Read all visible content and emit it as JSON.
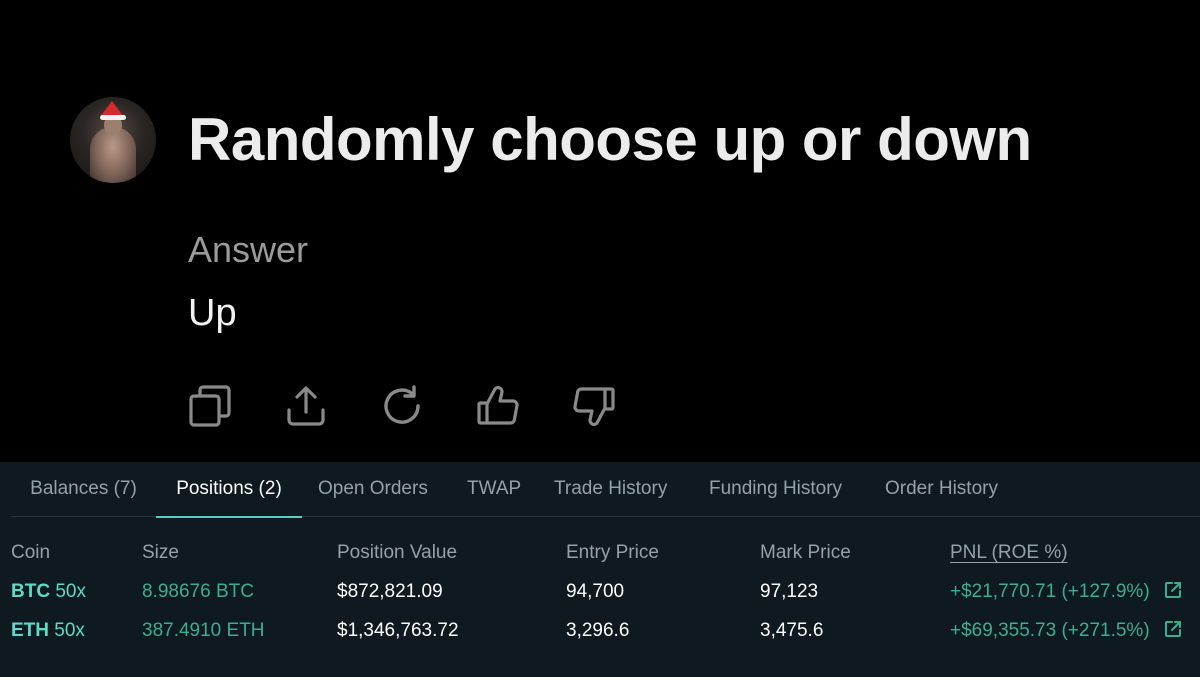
{
  "chat": {
    "question": "Randomly choose up or down",
    "answer_label": "Answer",
    "answer_text": "Up",
    "actions": [
      {
        "icon": "copy-icon"
      },
      {
        "icon": "share-icon"
      },
      {
        "icon": "regenerate-icon"
      },
      {
        "icon": "thumbs-up-icon"
      },
      {
        "icon": "thumbs-down-icon"
      }
    ]
  },
  "trading": {
    "tabs": [
      {
        "label": "Balances (7)",
        "active": false
      },
      {
        "label": "Positions (2)",
        "active": true
      },
      {
        "label": "Open Orders",
        "active": false
      },
      {
        "label": "TWAP",
        "active": false
      },
      {
        "label": "Trade History",
        "active": false
      },
      {
        "label": "Funding History",
        "active": false
      },
      {
        "label": "Order History",
        "active": false
      }
    ],
    "columns": {
      "coin": "Coin",
      "size": "Size",
      "position_value": "Position Value",
      "entry_price": "Entry Price",
      "mark_price": "Mark Price",
      "pnl": "PNL (ROE %)"
    },
    "rows": [
      {
        "coin": "BTC",
        "leverage": "50x",
        "size": "8.98676 BTC",
        "position_value": "$872,821.09",
        "entry_price": "94,700",
        "mark_price": "97,123",
        "pnl": "+$21,770.71 (+127.9%)"
      },
      {
        "coin": "ETH",
        "leverage": "50x",
        "size": "387.4910 ETH",
        "position_value": "$1,346,763.72",
        "entry_price": "3,296.6",
        "mark_price": "3,475.6",
        "pnl": "+$69,355.73 (+271.5%)"
      }
    ]
  },
  "colors": {
    "background_top": "#000000",
    "panel_background": "#0e1a1f",
    "accent": "#50d2c1",
    "positive": "#3cae8e",
    "muted": "#94a1a7"
  }
}
